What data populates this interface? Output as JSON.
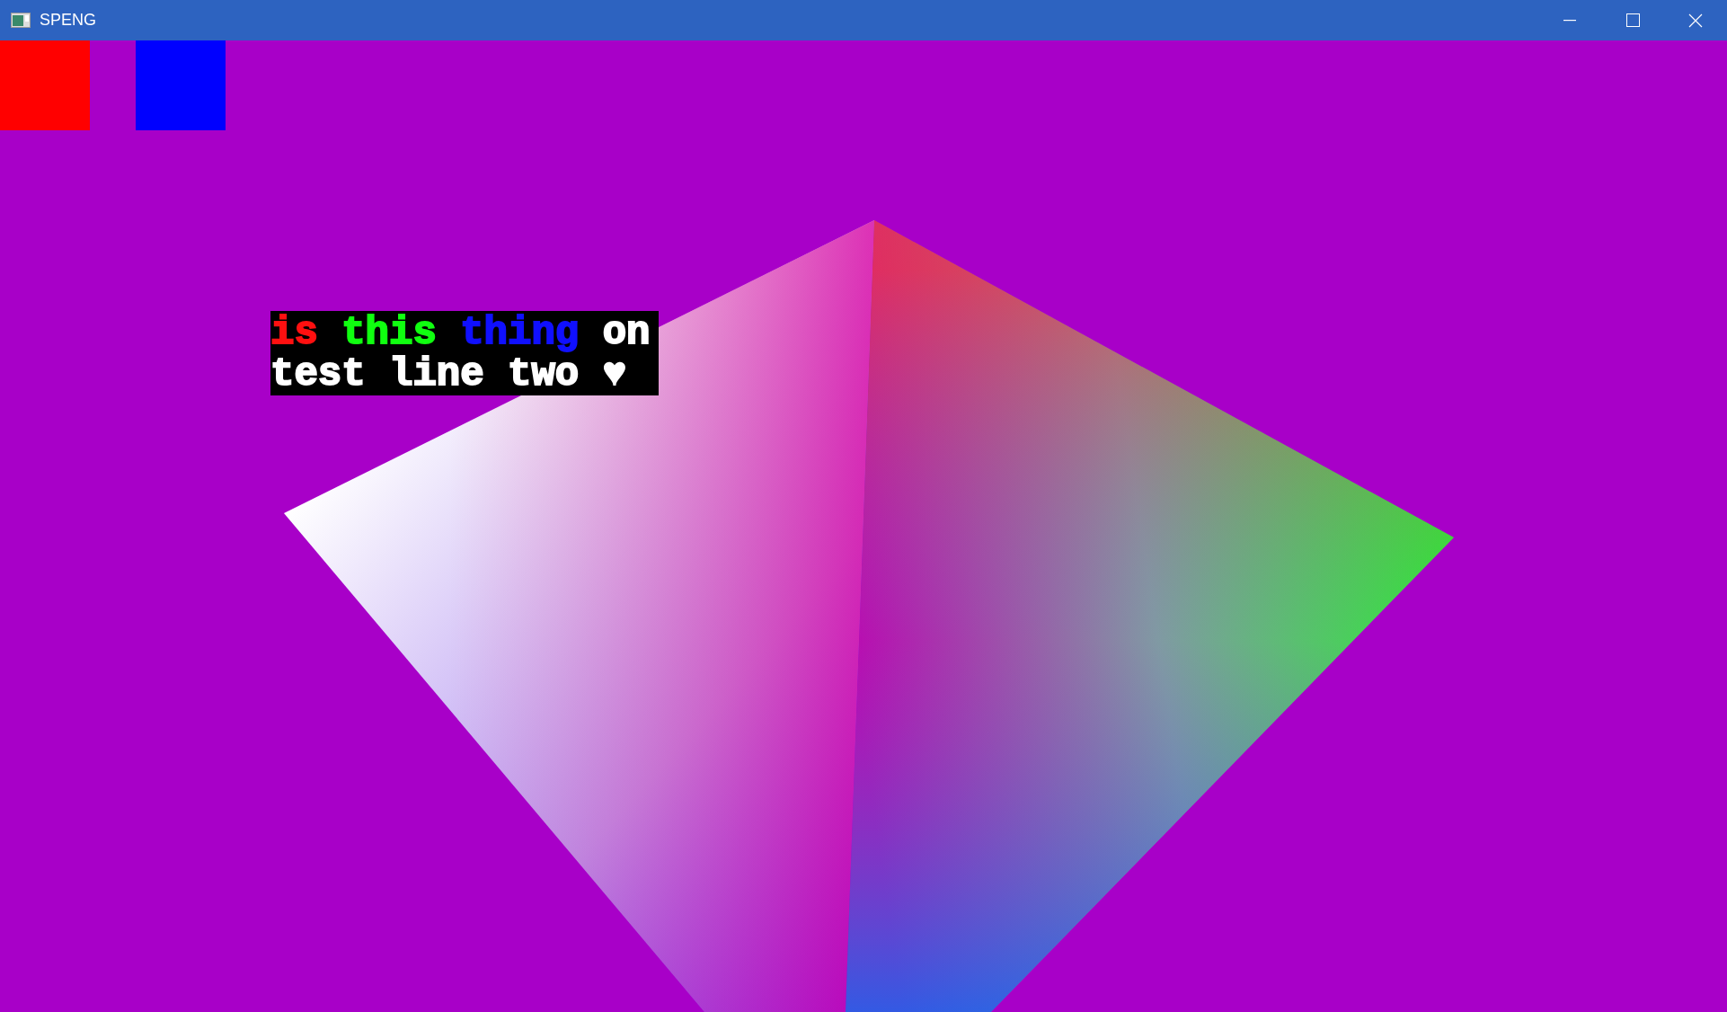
{
  "window": {
    "title": "SPENG"
  },
  "squares": [
    {
      "color": "#ff0000"
    },
    {
      "color": "#0000ff"
    }
  ],
  "text_overlay": {
    "lines": [
      {
        "segments": [
          {
            "text": "is",
            "color": "#ff1010"
          },
          {
            "text": "this",
            "color": "#10ff10"
          },
          {
            "text": "thing",
            "color": "#1010ff"
          },
          {
            "text": "on",
            "color": "#ffffff"
          }
        ]
      },
      {
        "segments": [
          {
            "text": "test",
            "color": "#ffffff"
          },
          {
            "text": "line",
            "color": "#ffffff"
          },
          {
            "text": "two",
            "color": "#ffffff"
          },
          {
            "text": "♥",
            "color": "#ffffff"
          }
        ]
      }
    ]
  }
}
